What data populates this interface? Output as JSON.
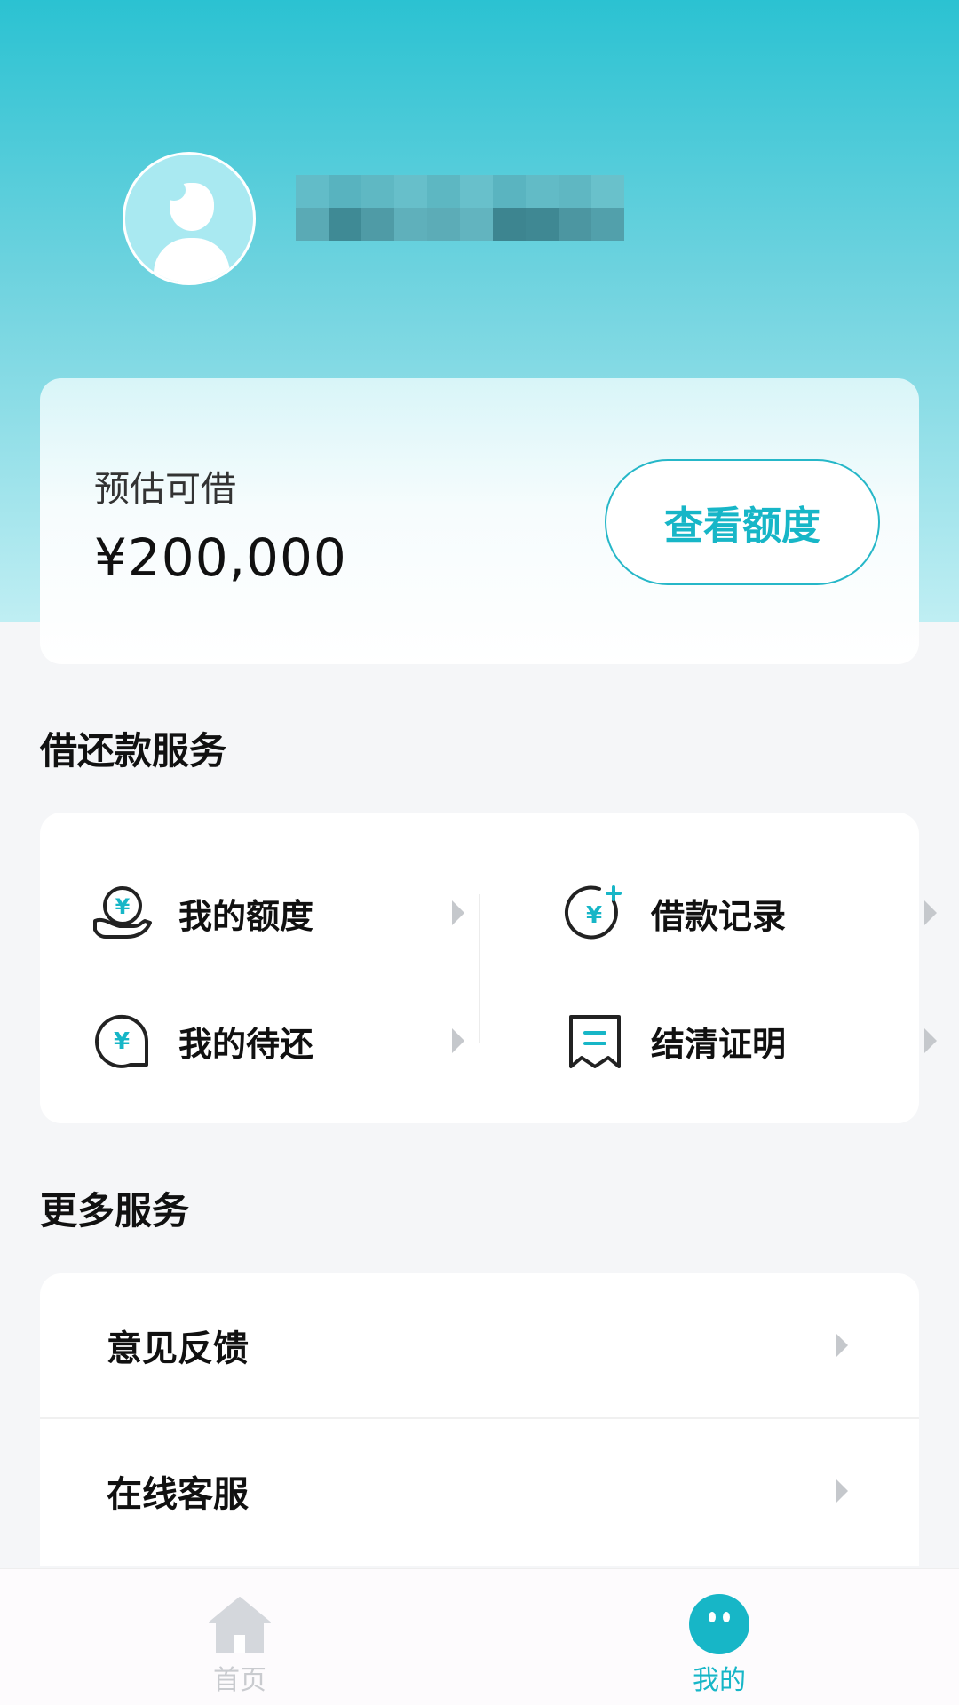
{
  "profile": {
    "username_hidden": true
  },
  "estimate": {
    "label": "预估可借",
    "amount": "¥200,000",
    "button_label": "查看额度"
  },
  "loan_services": {
    "title": "借还款服务",
    "items": [
      {
        "label": "我的额度",
        "icon": "hand-yen-icon"
      },
      {
        "label": "借款记录",
        "icon": "yen-plus-circle-icon"
      },
      {
        "label": "我的待还",
        "icon": "yen-chat-bubble-icon"
      },
      {
        "label": "结清证明",
        "icon": "receipt-icon"
      }
    ]
  },
  "more_services": {
    "title": "更多服务",
    "items": [
      {
        "label": "意见反馈"
      },
      {
        "label": "在线客服"
      }
    ]
  },
  "bottom_nav": {
    "items": [
      {
        "label": "首页",
        "icon": "home-icon",
        "active": false
      },
      {
        "label": "我的",
        "icon": "smiley-icon",
        "active": true
      }
    ]
  },
  "colors": {
    "accent": "#17b6c7",
    "header_top": "#2bc2d2",
    "page_bg": "#f5f6f8",
    "inactive_icon": "#c5c8cc"
  }
}
